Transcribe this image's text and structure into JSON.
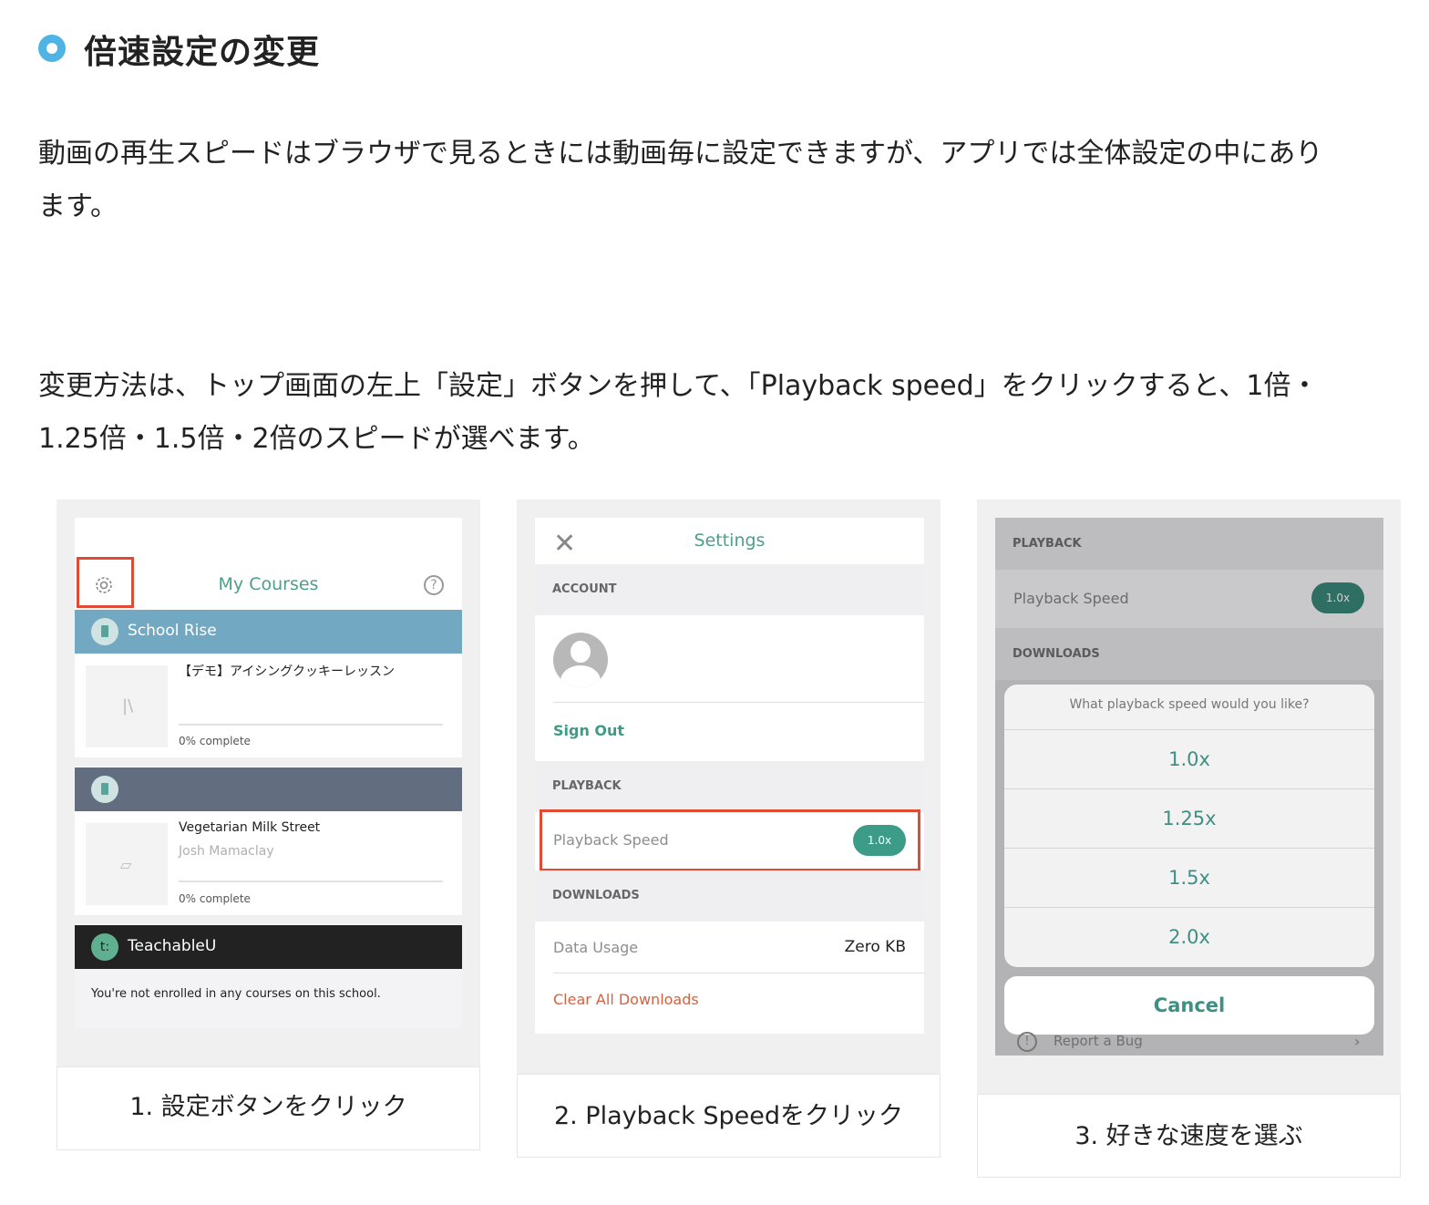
{
  "heading": {
    "title": "倍速設定の変更"
  },
  "paragraph1": {
    "line1": "動画の再生スピードはブラウザで見るときには動画毎に設定できますが、アプリでは全体設定の中にあり",
    "line2": "ます。"
  },
  "paragraph2": {
    "line1": "変更方法は、トップ画面の左上「設定」ボタンを押して、「Playback speed」をクリックすると、1倍・",
    "line2": "1.25倍・1.5倍・2倍のスピードが選べます。"
  },
  "step1": {
    "caption": "1. 設定ボタンをクリック",
    "title": "My Courses",
    "school1": {
      "name": "School Rise",
      "course": "【デモ】アイシングクッキーレッスン",
      "progress": "0% complete"
    },
    "school2": {
      "name": "",
      "course": "Vegetarian Milk Street",
      "author": "Josh Mamaclay",
      "progress": "0% complete"
    },
    "school3": {
      "name": "TeachableU",
      "badge": "t:",
      "message": "You're not enrolled in any courses on this school."
    }
  },
  "step2": {
    "caption": "2. Playback Speedをクリック",
    "title": "Settings",
    "account_header": "ACCOUNT",
    "sign_out": "Sign Out",
    "playback_header": "PLAYBACK",
    "playback_label": "Playback Speed",
    "playback_value": "1.0x",
    "downloads_header": "DOWNLOADS",
    "data_usage_label": "Data Usage",
    "data_usage_value": "Zero KB",
    "clear_downloads": "Clear All Downloads"
  },
  "step3": {
    "caption": "3. 好きな速度を選ぶ",
    "playback_header": "PLAYBACK",
    "playback_label": "Playback Speed",
    "playback_value": "1.0x",
    "downloads_header": "DOWNLOADS",
    "sheet_title": "What playback speed would you like?",
    "options": [
      "1.0x",
      "1.25x",
      "1.5x",
      "2.0x"
    ],
    "cancel": "Cancel",
    "report_bug": "Report a Bug"
  },
  "colors": {
    "accent_teal": "#3d9c88",
    "highlight_red": "#e04b35",
    "heading_dot": "#4fb3e4"
  }
}
